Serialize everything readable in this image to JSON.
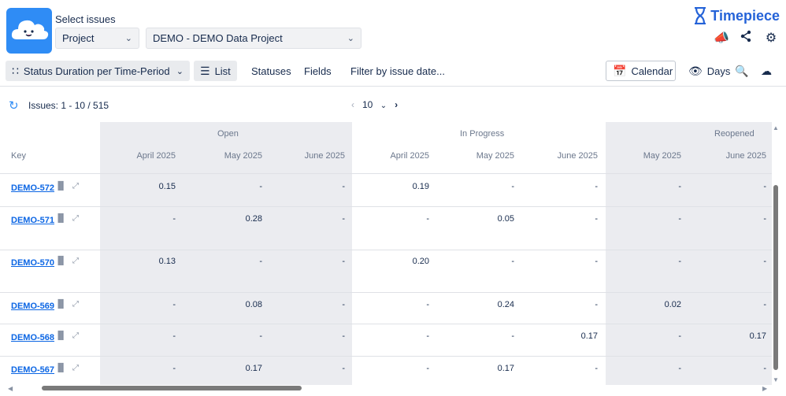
{
  "header": {
    "select_label": "Select issues",
    "scope_select": "Project",
    "project_select": "DEMO - DEMO Data Project",
    "brand": "Timepiece",
    "brand_color": "#2563d8",
    "logo_color": "#2f8cf5",
    "icons": [
      "megaphone-icon",
      "share-icon",
      "gear-icon"
    ]
  },
  "toolbar": {
    "report": "Status Duration per Time-Period",
    "list": "List",
    "statuses": "Statuses",
    "fields": "Fields",
    "filter": "Filter by issue date...",
    "calendar": "Calendar",
    "days": "Days"
  },
  "paging": {
    "issues": "Issues: 1 - 10 / 515",
    "page_size": "10"
  },
  "table": {
    "key_header": "Key",
    "groups": [
      "Open",
      "In Progress",
      "Reopened"
    ],
    "columns": [
      "April 2025",
      "May 2025",
      "June 2025",
      "April 2025",
      "May 2025",
      "June 2025",
      "May 2025",
      "June 2025"
    ],
    "rows": [
      {
        "key": "DEMO-572",
        "values": [
          "0.15",
          "-",
          "-",
          "0.19",
          "-",
          "-",
          "-",
          "-"
        ]
      },
      {
        "key": "DEMO-571",
        "values": [
          "-",
          "0.28",
          "-",
          "-",
          "0.05",
          "-",
          "-",
          "-"
        ]
      },
      {
        "key": "DEMO-570",
        "values": [
          "0.13",
          "-",
          "-",
          "0.20",
          "-",
          "-",
          "-",
          "-"
        ]
      },
      {
        "key": "DEMO-569",
        "values": [
          "-",
          "0.08",
          "-",
          "-",
          "0.24",
          "-",
          "0.02",
          "-"
        ]
      },
      {
        "key": "DEMO-568",
        "values": [
          "-",
          "-",
          "-",
          "-",
          "-",
          "0.17",
          "-",
          "0.17"
        ]
      },
      {
        "key": "DEMO-567",
        "values": [
          "-",
          "0.17",
          "-",
          "-",
          "0.17",
          "-",
          "-",
          "-"
        ]
      }
    ]
  }
}
